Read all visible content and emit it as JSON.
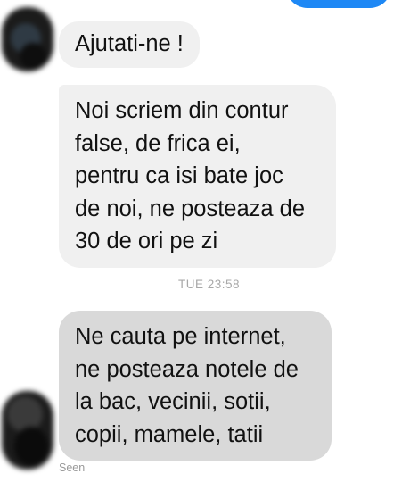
{
  "conversation": {
    "messages": [
      {
        "lines": [
          "Ajutati-ne !"
        ]
      },
      {
        "lines": [
          "Noi scriem din contur",
          "false, de frica ei,",
          "pentru ca isi bate joc",
          "de noi, ne posteaza de",
          "30 de ori pe zi"
        ]
      },
      {
        "lines": [
          "Ne cauta pe internet,",
          "ne posteaza notele de",
          "la bac, vecinii, sotii,",
          "copii, mamele, tatii"
        ]
      }
    ],
    "timestamp": "TUE 23:58",
    "status": "Seen"
  },
  "colors": {
    "sent_bubble": "#1e88f5",
    "received_bubble": "#f0f0f0",
    "highlighted_bubble": "#d9d9d9"
  }
}
